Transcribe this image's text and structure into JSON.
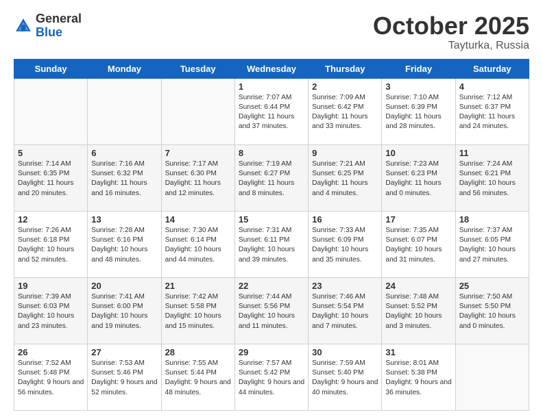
{
  "header": {
    "logo_general": "General",
    "logo_blue": "Blue",
    "month": "October 2025",
    "location": "Tayturka, Russia"
  },
  "days_of_week": [
    "Sunday",
    "Monday",
    "Tuesday",
    "Wednesday",
    "Thursday",
    "Friday",
    "Saturday"
  ],
  "weeks": [
    [
      {
        "day": "",
        "text": ""
      },
      {
        "day": "",
        "text": ""
      },
      {
        "day": "",
        "text": ""
      },
      {
        "day": "1",
        "text": "Sunrise: 7:07 AM\nSunset: 6:44 PM\nDaylight: 11 hours and 37 minutes."
      },
      {
        "day": "2",
        "text": "Sunrise: 7:09 AM\nSunset: 6:42 PM\nDaylight: 11 hours and 33 minutes."
      },
      {
        "day": "3",
        "text": "Sunrise: 7:10 AM\nSunset: 6:39 PM\nDaylight: 11 hours and 28 minutes."
      },
      {
        "day": "4",
        "text": "Sunrise: 7:12 AM\nSunset: 6:37 PM\nDaylight: 11 hours and 24 minutes."
      }
    ],
    [
      {
        "day": "5",
        "text": "Sunrise: 7:14 AM\nSunset: 6:35 PM\nDaylight: 11 hours and 20 minutes."
      },
      {
        "day": "6",
        "text": "Sunrise: 7:16 AM\nSunset: 6:32 PM\nDaylight: 11 hours and 16 minutes."
      },
      {
        "day": "7",
        "text": "Sunrise: 7:17 AM\nSunset: 6:30 PM\nDaylight: 11 hours and 12 minutes."
      },
      {
        "day": "8",
        "text": "Sunrise: 7:19 AM\nSunset: 6:27 PM\nDaylight: 11 hours and 8 minutes."
      },
      {
        "day": "9",
        "text": "Sunrise: 7:21 AM\nSunset: 6:25 PM\nDaylight: 11 hours and 4 minutes."
      },
      {
        "day": "10",
        "text": "Sunrise: 7:23 AM\nSunset: 6:23 PM\nDaylight: 11 hours and 0 minutes."
      },
      {
        "day": "11",
        "text": "Sunrise: 7:24 AM\nSunset: 6:21 PM\nDaylight: 10 hours and 56 minutes."
      }
    ],
    [
      {
        "day": "12",
        "text": "Sunrise: 7:26 AM\nSunset: 6:18 PM\nDaylight: 10 hours and 52 minutes."
      },
      {
        "day": "13",
        "text": "Sunrise: 7:28 AM\nSunset: 6:16 PM\nDaylight: 10 hours and 48 minutes."
      },
      {
        "day": "14",
        "text": "Sunrise: 7:30 AM\nSunset: 6:14 PM\nDaylight: 10 hours and 44 minutes."
      },
      {
        "day": "15",
        "text": "Sunrise: 7:31 AM\nSunset: 6:11 PM\nDaylight: 10 hours and 39 minutes."
      },
      {
        "day": "16",
        "text": "Sunrise: 7:33 AM\nSunset: 6:09 PM\nDaylight: 10 hours and 35 minutes."
      },
      {
        "day": "17",
        "text": "Sunrise: 7:35 AM\nSunset: 6:07 PM\nDaylight: 10 hours and 31 minutes."
      },
      {
        "day": "18",
        "text": "Sunrise: 7:37 AM\nSunset: 6:05 PM\nDaylight: 10 hours and 27 minutes."
      }
    ],
    [
      {
        "day": "19",
        "text": "Sunrise: 7:39 AM\nSunset: 6:03 PM\nDaylight: 10 hours and 23 minutes."
      },
      {
        "day": "20",
        "text": "Sunrise: 7:41 AM\nSunset: 6:00 PM\nDaylight: 10 hours and 19 minutes."
      },
      {
        "day": "21",
        "text": "Sunrise: 7:42 AM\nSunset: 5:58 PM\nDaylight: 10 hours and 15 minutes."
      },
      {
        "day": "22",
        "text": "Sunrise: 7:44 AM\nSunset: 5:56 PM\nDaylight: 10 hours and 11 minutes."
      },
      {
        "day": "23",
        "text": "Sunrise: 7:46 AM\nSunset: 5:54 PM\nDaylight: 10 hours and 7 minutes."
      },
      {
        "day": "24",
        "text": "Sunrise: 7:48 AM\nSunset: 5:52 PM\nDaylight: 10 hours and 3 minutes."
      },
      {
        "day": "25",
        "text": "Sunrise: 7:50 AM\nSunset: 5:50 PM\nDaylight: 10 hours and 0 minutes."
      }
    ],
    [
      {
        "day": "26",
        "text": "Sunrise: 7:52 AM\nSunset: 5:48 PM\nDaylight: 9 hours and 56 minutes."
      },
      {
        "day": "27",
        "text": "Sunrise: 7:53 AM\nSunset: 5:46 PM\nDaylight: 9 hours and 52 minutes."
      },
      {
        "day": "28",
        "text": "Sunrise: 7:55 AM\nSunset: 5:44 PM\nDaylight: 9 hours and 48 minutes."
      },
      {
        "day": "29",
        "text": "Sunrise: 7:57 AM\nSunset: 5:42 PM\nDaylight: 9 hours and 44 minutes."
      },
      {
        "day": "30",
        "text": "Sunrise: 7:59 AM\nSunset: 5:40 PM\nDaylight: 9 hours and 40 minutes."
      },
      {
        "day": "31",
        "text": "Sunrise: 8:01 AM\nSunset: 5:38 PM\nDaylight: 9 hours and 36 minutes."
      },
      {
        "day": "",
        "text": ""
      }
    ]
  ]
}
